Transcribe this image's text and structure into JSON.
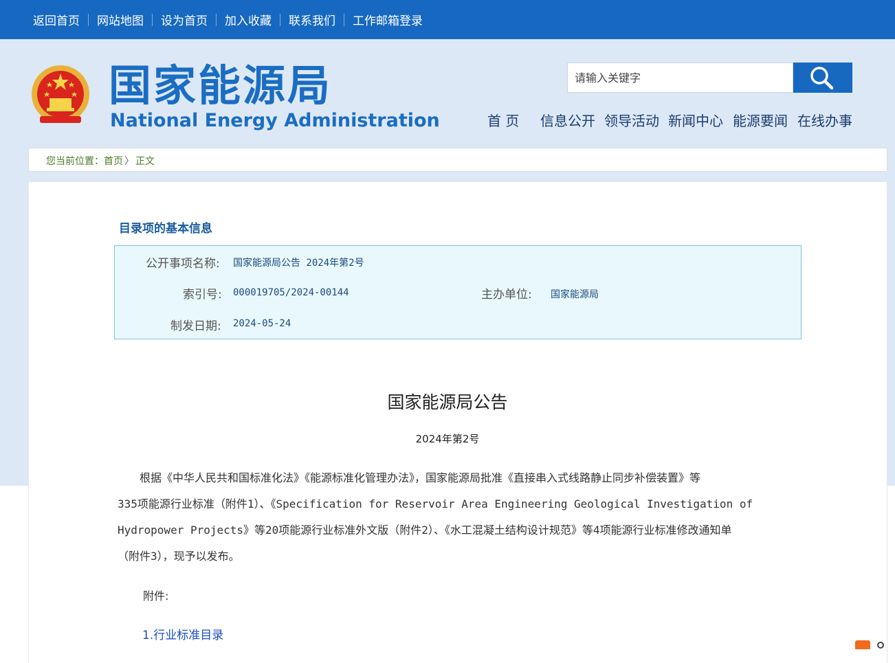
{
  "topbar": {
    "links": [
      "返回首页",
      "网站地图",
      "设为首页",
      "加入收藏",
      "联系我们",
      "工作邮箱登录"
    ]
  },
  "header": {
    "title_cn": "国家能源局",
    "title_en": "National Energy Administration",
    "search_placeholder": "请输入关键字"
  },
  "nav": {
    "items": [
      "首 页",
      "信息公开",
      "领导活动",
      "新闻中心",
      "能源要闻",
      "在线办事"
    ]
  },
  "breadcrumb": {
    "prefix": "您当前位置：",
    "home": "首页",
    "sep": "〉",
    "current": "正文"
  },
  "info": {
    "section_title": "目录项的基本信息",
    "name_label": "公开事项名称:",
    "name_value": "国家能源局公告 2024年第2号",
    "index_label": "索引号:",
    "index_value": "000019705/2024-00144",
    "org_label": "主办单位:",
    "org_value": "国家能源局",
    "date_label": "制发日期:",
    "date_value": "2024-05-24"
  },
  "document": {
    "title": "国家能源局公告",
    "number": "2024年第2号",
    "body_lines": [
      "　　根据《中华人民共和国标准化法》《能源标准化管理办法》，国家能源局批准《直接串入式线路静止同步补偿装置》等",
      "335项能源行业标准（附件1）、《Specification for Reservoir Area Engineering Geological Investigation of",
      "Hydropower Projects》等20项能源行业标准外文版（附件2）、《水工混凝土结构设计规范》等4项能源行业标准修改通知单",
      "（附件3），现予以发布。"
    ],
    "attachments_label": "附件:",
    "attachment_1": "1.行业标准目录"
  },
  "colors": {
    "topbar": "#1668c0",
    "hero_bg": "#dde8f6",
    "brand": "#1a6dc2",
    "info_bg": "#e9f8fc",
    "info_border": "#7ec6dd",
    "link": "#1a4ec2"
  }
}
